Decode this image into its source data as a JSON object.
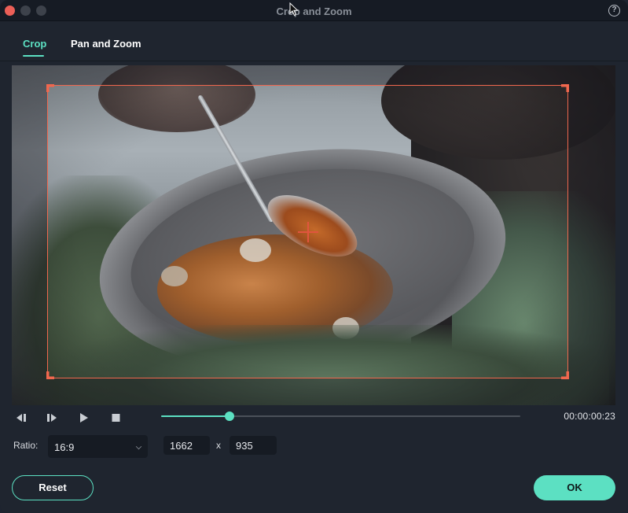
{
  "window": {
    "title": "Crop and Zoom",
    "help_icon": "question-circle-icon",
    "traffic_lights": [
      "close",
      "minimize",
      "maximize"
    ]
  },
  "tabs": [
    {
      "label": "Crop",
      "active": true
    },
    {
      "label": "Pan and Zoom",
      "active": false
    }
  ],
  "preview": {
    "description": "Video frame: a spoon drizzling syrup over mushrooms in a stone bowl surrounded by greenery",
    "crop_box_color": "#f0674e"
  },
  "playback": {
    "prev_frame_icon": "step-backward-icon",
    "next_frame_icon": "step-forward-icon",
    "play_icon": "play-icon",
    "stop_icon": "stop-icon",
    "progress": 0.19,
    "timecode": "00:00:00:23"
  },
  "ratio": {
    "label": "Ratio:",
    "selected": "16:9",
    "width": "1662",
    "separator": "x",
    "height": "935"
  },
  "buttons": {
    "reset": "Reset",
    "ok": "OK"
  },
  "colors": {
    "accent": "#5ce0c2",
    "crop": "#f0674e",
    "background": "#1f252f"
  }
}
